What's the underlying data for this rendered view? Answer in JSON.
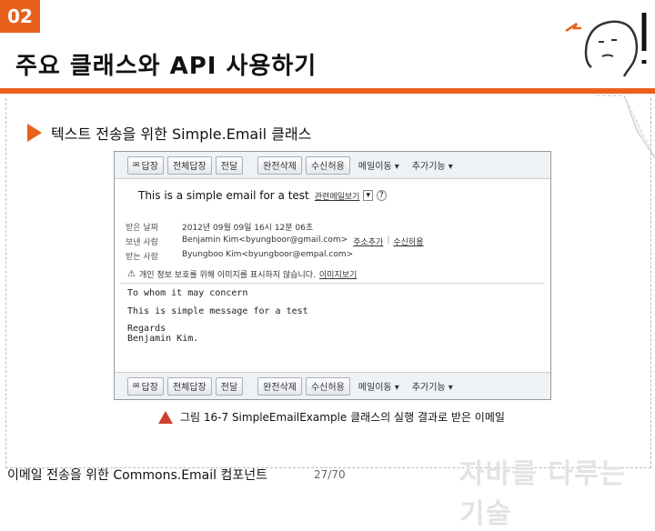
{
  "slide": {
    "badge": "02",
    "title": "주요 클래스와 API 사용하기",
    "section_heading": "텍스트 전송을 위한 Simple.Email 클래스",
    "caption": "그림 16-7 SimpleEmailExample 클래스의 실행 결과로 받은 이메일",
    "footer_left": "이메일 전송을 위한 Commons.Email 컴포넌트",
    "page": "27/70",
    "brand": "자바를 다루는 기술",
    "accent_color": "#e8601c"
  },
  "mail": {
    "toolbar": [
      {
        "label": "답장",
        "icon": "reply-icon"
      },
      {
        "label": "전체답장"
      },
      {
        "label": "전달"
      },
      {
        "label": "완전삭제"
      },
      {
        "label": "수신허용"
      },
      {
        "label": "메일이동 ▾"
      },
      {
        "label": "추가기능 ▾"
      }
    ],
    "subject": "This is a simple email for a test",
    "related_link": "관련메일보기",
    "headers": {
      "date_key": "받은 날짜",
      "date_val": "2012년 09월 09일 16시 12분 06초",
      "from_key": "보낸 사람",
      "from_val": "Benjamin Kim<byungboor@gmail.com>",
      "add_contact": "주소추가",
      "allow": "수신허용",
      "to_key": "받는 사람",
      "to_val": "Byungboo Kim<byungboor@empal.com>"
    },
    "warning": "개인 정보 보호를 위해 이미지를 표시하지 않습니다.",
    "show_images": "이미지보기",
    "body": {
      "greeting": "To whom it may concern",
      "message": "This is simple message for a test",
      "closing": "Regards",
      "signature": "Benjamin Kim."
    }
  }
}
